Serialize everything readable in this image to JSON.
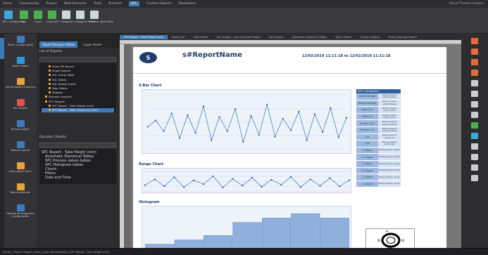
{
  "menu": {
    "items": [
      "Home",
      "Connectivity",
      "Project",
      "Web Elements",
      "Tools",
      "Runtime",
      "SPC",
      "Custom Objects",
      "Dashboard"
    ],
    "active_index": 6,
    "right_text": "Visual Theme ▾  Help ▾"
  },
  "ribbon": {
    "buttons": [
      {
        "label": "SPC Configuration",
        "color": "#3fa7d6"
      },
      {
        "label": "Bar",
        "color": "#4caf50"
      },
      {
        "label": "Chart",
        "color": "#4caf50"
      },
      {
        "label": "Chart SPC",
        "color": "#4caf50"
      },
      {
        "label": "Histogram",
        "color": "#cfd8dc"
      },
      {
        "label": "Histogram table",
        "color": "#cfd8dc"
      },
      {
        "label": "Process value table",
        "color": "#cfd8dc"
      }
    ]
  },
  "sidebar": {
    "items": [
      {
        "label": "Driver Configuration",
        "color": "#3e7ab8"
      },
      {
        "label": "Data models",
        "color": "#2e9bd6"
      },
      {
        "label": "Virtual Report Instances",
        "color": "#e9a13b"
      },
      {
        "label": "Run Project",
        "color": "#d9544d"
      },
      {
        "label": "Reload project",
        "color": "#3e7ab8"
      },
      {
        "label": "Reload reports",
        "color": "#3e7ab8"
      },
      {
        "label": "Edit project users",
        "color": "#e9a13b"
      },
      {
        "label": "Batch definition",
        "color": "#e9a13b"
      },
      {
        "label": "Remote Development Configuration",
        "color": "#3e7ab8"
      }
    ]
  },
  "panel": {
    "tabs": [
      "Report Designer Nodes",
      "Logger Nodes"
    ],
    "list_title": "List of Reports",
    "tree": [
      {
        "label": "Sales KPI Report",
        "indent": 2,
        "selected": false
      },
      {
        "label": "Single objects",
        "indent": 2,
        "selected": false
      },
      {
        "label": "SQL Group Table",
        "indent": 2,
        "selected": false
      },
      {
        "label": "SQL Tables",
        "indent": 2,
        "selected": false
      },
      {
        "label": "SQL Based Charts",
        "indent": 2,
        "selected": false
      },
      {
        "label": "Step Tables",
        "indent": 2,
        "selected": false
      },
      {
        "label": "Widgets",
        "indent": 2,
        "selected": false
      },
      {
        "label": "Setpoint Analysis",
        "indent": 1,
        "selected": false
      },
      {
        "label": "SPC Reports",
        "indent": 1,
        "selected": false
      },
      {
        "label": "SPC Report - Tube Height (mm)",
        "indent": 2,
        "selected": false
      },
      {
        "label": "SPC Report - Tube Thickness (mm)",
        "indent": 2,
        "selected": true
      }
    ],
    "dynamic_title": "Dynamic Objects",
    "tree2": [
      {
        "label": "SPC Report - Tube Height (mm)",
        "indent": 0
      },
      {
        "label": "Automatic Statistical Tables",
        "indent": 1
      },
      {
        "label": "SPC Process values tables",
        "indent": 1
      },
      {
        "label": "SPC Histogram tables",
        "indent": 1
      },
      {
        "label": "Charts",
        "indent": 1
      },
      {
        "label": "Filters",
        "indent": 1
      },
      {
        "label": "Date and Time",
        "indent": 1
      }
    ]
  },
  "doc": {
    "tabs": [
      "SPC Report - Tube Height (mm)",
      "Report_DC",
      "Data Tables",
      "Bar Graphs - Line Overview Report",
      "Bar Graphs",
      "Automatic Statistical Tables",
      "Alarm Tables",
      "Custom Objects",
      "Multi Language Report"
    ],
    "active_tab": 0
  },
  "report": {
    "logo_letter": "S",
    "name": "s#ReportName",
    "date_from": "12/02/2019 11:11:18",
    "to_word": "to",
    "date_to": "12/02/2019 11:11:18",
    "xbar_title": "X-Bar Chart",
    "range_title": "Range Chart",
    "hist_title": "Histogram"
  },
  "spc_table": {
    "title": "SPC Calculations",
    "rows": [
      {
        "k": "Grand Avrage",
        "v": "#Tube_Datum ean#_Grand"
      },
      {
        "k": "Range Average",
        "v": "#Tube_Datum ean#_Range"
      },
      {
        "k": "X-Bar UCL",
        "v": "#Tube_Datum ean#_value"
      },
      {
        "k": "X-Bar LCL",
        "v": "#Tube_Datum ean#_value"
      },
      {
        "k": "R-Chart UCL",
        "v": "#Tube_Datum ean#_R-Chart"
      },
      {
        "k": "R-Chart LCL",
        "v": "#Tube_Datum ean#_R-Chart"
      },
      {
        "k": "Cp",
        "v": "#Tube_Datum ean#_Cp"
      },
      {
        "k": "Cpk",
        "v": "#Tube_Datum ean#_Cpk"
      },
      {
        "k": "-3 Sigma",
        "v": "#Tube_Datum ean#_"
      },
      {
        "k": "+3 Sigma",
        "v": "#Tube_Datum ean#_"
      },
      {
        "k": "-2 Sigma",
        "v": "#Tube_Datum ean#_"
      },
      {
        "k": "+2 Sigma",
        "v": "#Tube_Datum ean#_"
      },
      {
        "k": "-1 Sigma",
        "v": "#Tube_Datum ean#_"
      },
      {
        "k": "+1 Sigma",
        "v": "#Tube_Datum ean#_"
      }
    ]
  },
  "sketch": {
    "labels": [
      "H",
      "ID",
      "W",
      "OD"
    ]
  },
  "status": "Ready  |  Project: Report_Demo  |  User: Administrator  |  SPC Report - Tube Height (mm)",
  "chart_data": [
    {
      "type": "line",
      "title": "X-Bar Chart",
      "values": [
        35,
        42,
        30,
        50,
        22,
        48,
        28,
        58,
        20,
        46,
        30,
        55,
        18,
        47,
        26,
        60,
        24,
        44,
        31,
        52,
        20,
        49,
        29,
        56,
        23,
        45
      ],
      "ylim": [
        10,
        70
      ]
    },
    {
      "type": "line",
      "title": "Range Chart",
      "values": [
        30,
        60,
        25,
        70,
        20,
        55,
        35,
        75,
        18,
        62,
        28,
        68,
        22,
        58,
        32,
        72,
        20,
        60,
        26,
        66,
        24,
        56
      ],
      "ylim": [
        0,
        100
      ]
    },
    {
      "type": "bar",
      "title": "Histogram",
      "values": [
        1,
        2,
        3,
        6,
        7,
        8,
        7
      ],
      "ylim": [
        0,
        9
      ]
    }
  ]
}
